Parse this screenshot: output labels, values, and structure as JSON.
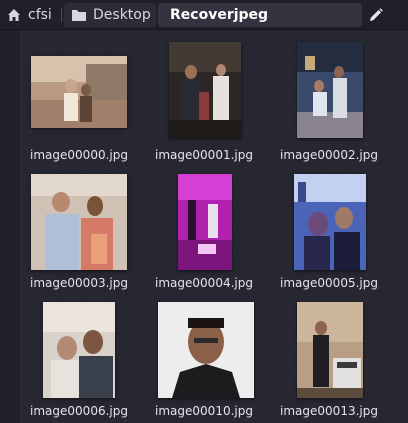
{
  "pathbar": {
    "home_label": "cfsi",
    "desktop_label": "Desktop",
    "current_label": "Recoverjpeg",
    "home_icon": "home-icon",
    "edit_icon": "pencil-icon"
  },
  "files": [
    {
      "name": "image00000.jpg"
    },
    {
      "name": "image00001.jpg"
    },
    {
      "name": "image00002.jpg"
    },
    {
      "name": "image00003.jpg"
    },
    {
      "name": "image00004.jpg"
    },
    {
      "name": "image00005.jpg"
    },
    {
      "name": "image00006.jpg"
    },
    {
      "name": "image00010.jpg"
    },
    {
      "name": "image00013.jpg"
    }
  ],
  "colors": {
    "background": "#252630",
    "pathbar": "#1f2029",
    "active_crumb": "#33343f",
    "text": "#e4e5ea"
  }
}
